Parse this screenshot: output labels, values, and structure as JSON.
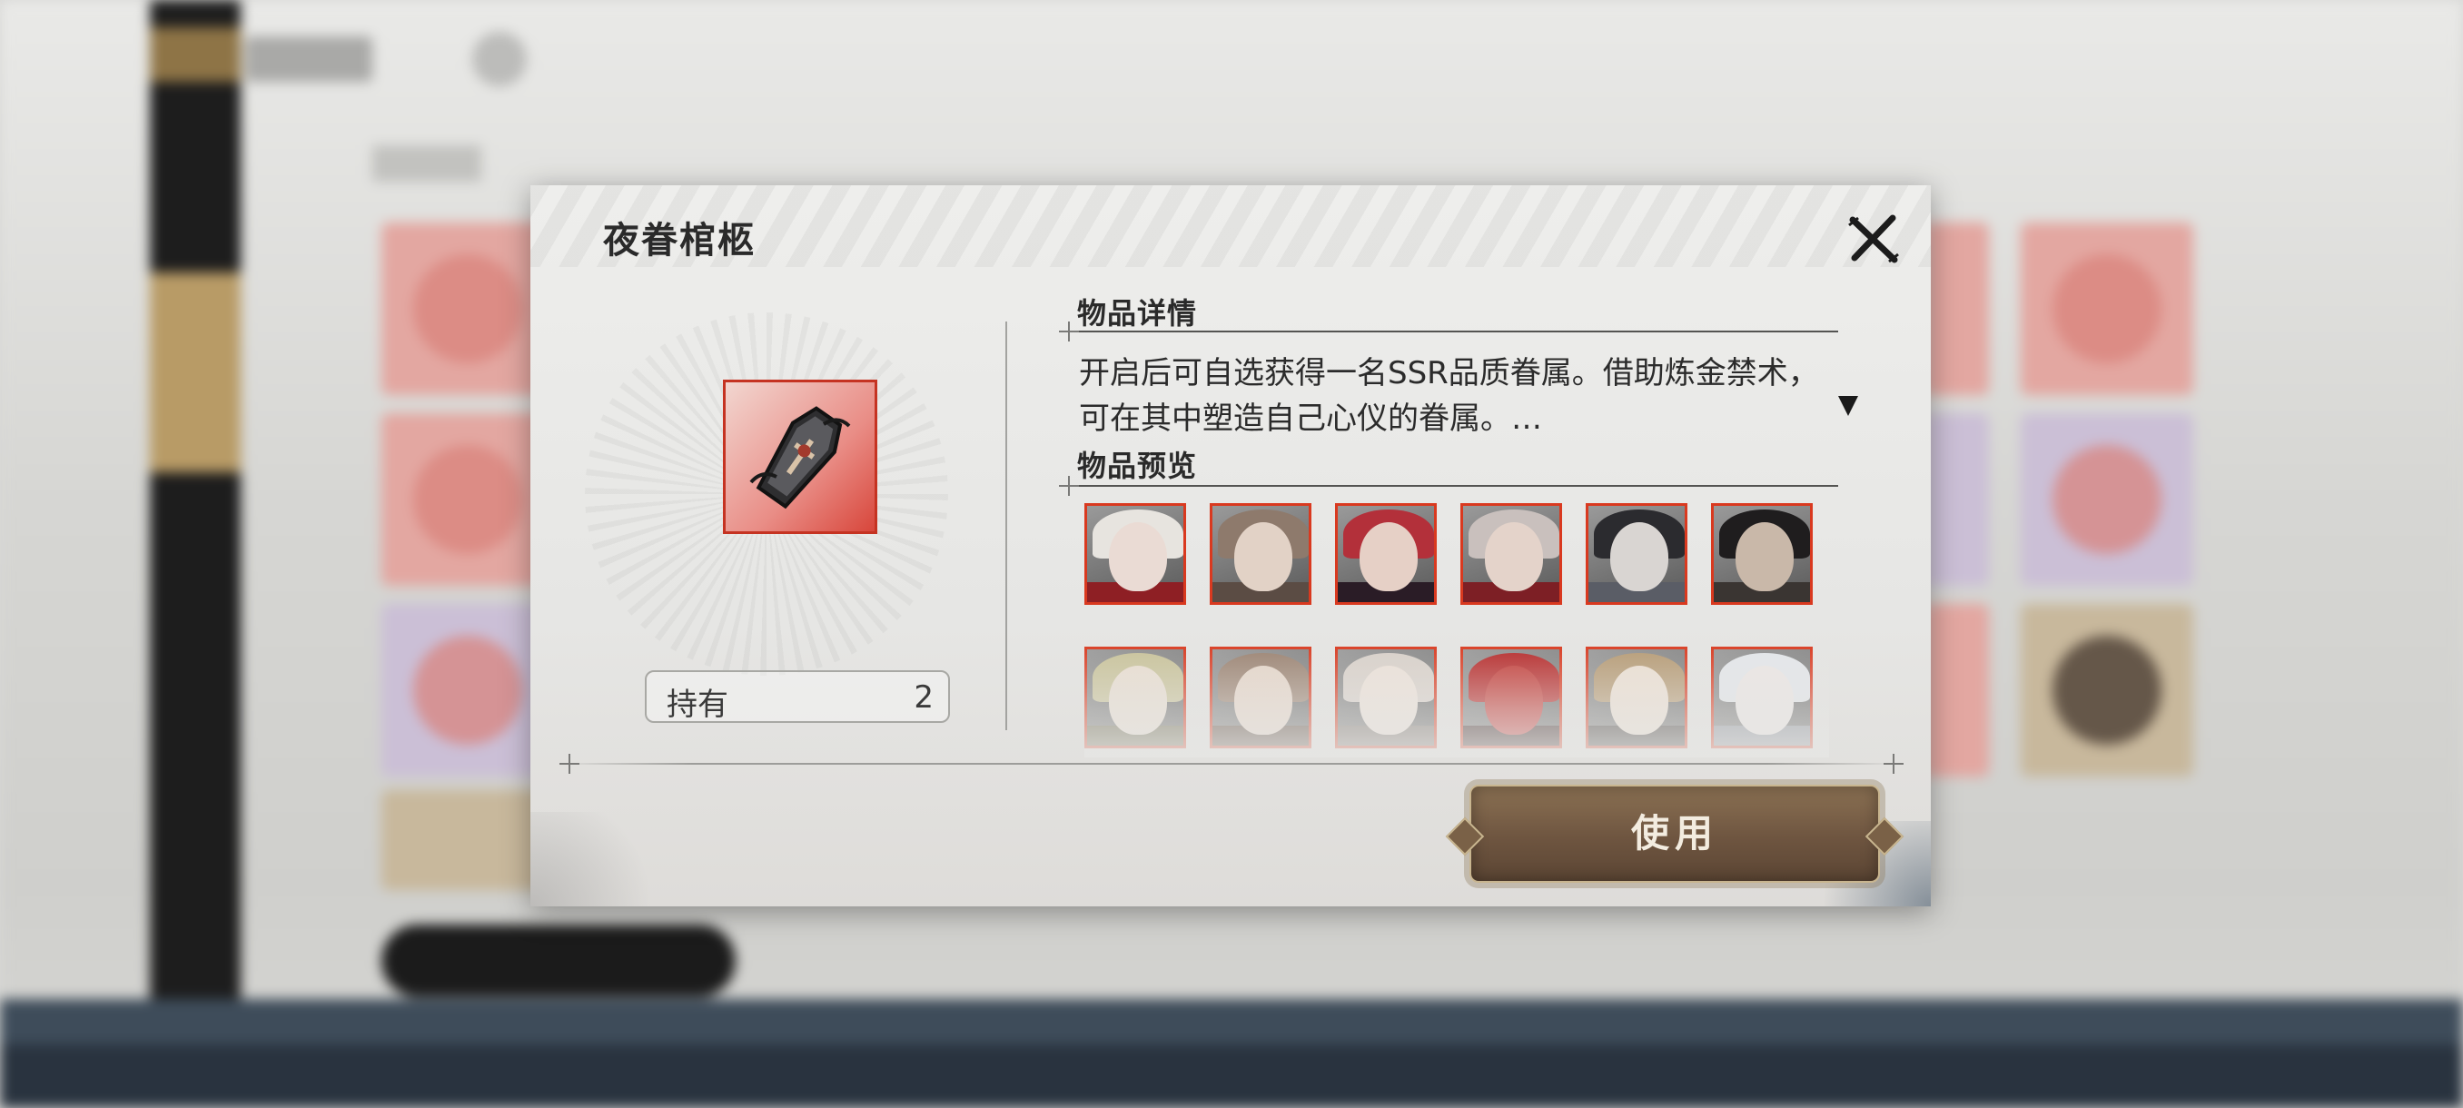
{
  "dialog": {
    "title": "夜眷棺柩",
    "owned_label": "持有",
    "owned_count": "2",
    "detail_title": "物品详情",
    "detail_text": "开启后可自选获得一名SSR品质眷属。借助炼金禁术，可在其中塑造自己心仪的眷属。…",
    "preview_title": "物品预览",
    "use_button": "使用",
    "preview_portraits": [
      {
        "hair": "#e7e4df",
        "face": "#eadbd4",
        "accent": "#8e1f24"
      },
      {
        "hair": "#8e7a6c",
        "face": "#e2d2c6",
        "accent": "#5b4c44"
      },
      {
        "hair": "#b3303a",
        "face": "#e6d0c6",
        "accent": "#2a1c26"
      },
      {
        "hair": "#c9c0bd",
        "face": "#e4d3ca",
        "accent": "#7d1f25"
      },
      {
        "hair": "#2b2b2f",
        "face": "#d9d5d2",
        "accent": "#5a5d66"
      },
      {
        "hair": "#1f1d1e",
        "face": "#c9b8a9",
        "accent": "#3a3532"
      },
      {
        "hair": "#c8c299",
        "face": "#e8ddd0",
        "accent": "#6e6a50"
      },
      {
        "hair": "#9a8271",
        "face": "#e5d5c8",
        "accent": "#5c4a3e"
      },
      {
        "hair": "#d8d0c9",
        "face": "#ece1d8",
        "accent": "#7b726c"
      },
      {
        "hair": "#b62a2a",
        "face": "#c23b37",
        "accent": "#3a2424"
      },
      {
        "hair": "#b59a74",
        "face": "#ecdfd2",
        "accent": "#3f3a38"
      },
      {
        "hair": "#e3e6ea",
        "face": "#ebe6e4",
        "accent": "#8a8f99"
      }
    ]
  },
  "colors": {
    "rarity_border": "#d9391f",
    "button_brown": "#6e5540",
    "button_gold": "#c8b58f"
  },
  "icons": {
    "close": "close-x-icon",
    "expand": "caret-down-icon",
    "item": "coffin-icon"
  }
}
